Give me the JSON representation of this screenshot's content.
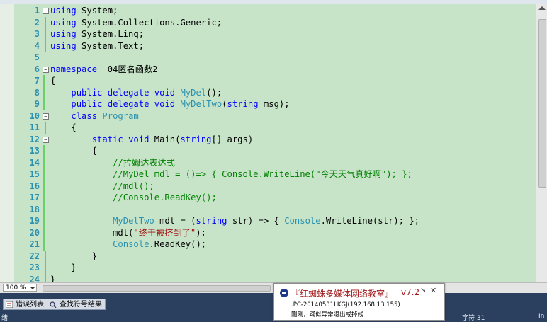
{
  "top_tabs": [
    "",
    ""
  ],
  "editor": {
    "lines": [
      {
        "n": "1",
        "fold": "−",
        "chg": false,
        "guide": false,
        "code": "<span class='kw'>using</span> System;"
      },
      {
        "n": "2",
        "fold": "",
        "chg": false,
        "guide": true,
        "code": "<span class='kw'>using</span> System.Collections.Generic;"
      },
      {
        "n": "3",
        "fold": "",
        "chg": false,
        "guide": true,
        "code": "<span class='kw'>using</span> System.Linq;"
      },
      {
        "n": "4",
        "fold": "",
        "chg": false,
        "guide": true,
        "code": "<span class='kw'>using</span> System.Text;"
      },
      {
        "n": "5",
        "fold": "",
        "chg": false,
        "guide": false,
        "code": ""
      },
      {
        "n": "6",
        "fold": "−",
        "chg": false,
        "guide": false,
        "code": "<span class='kw'>namespace</span> _04匿名函数2"
      },
      {
        "n": "7",
        "fold": "",
        "chg": true,
        "guide": false,
        "code": "{"
      },
      {
        "n": "8",
        "fold": "",
        "chg": true,
        "guide": false,
        "code": "    <span class='kw'>public</span> <span class='kw'>delegate</span> <span class='kw'>void</span> <span class='ty'>MyDel</span>();"
      },
      {
        "n": "9",
        "fold": "",
        "chg": true,
        "guide": false,
        "code": "    <span class='kw'>public</span> <span class='kw'>delegate</span> <span class='kw'>void</span> <span class='ty'>MyDelTwo</span>(<span class='kw'>string</span> msg);"
      },
      {
        "n": "10",
        "fold": "−",
        "chg": false,
        "guide": false,
        "code": "    <span class='kw'>class</span> <span class='ty'>Program</span>"
      },
      {
        "n": "11",
        "fold": "",
        "chg": false,
        "guide": true,
        "code": "    {"
      },
      {
        "n": "12",
        "fold": "−",
        "chg": false,
        "guide": false,
        "code": "        <span class='kw'>static</span> <span class='kw'>void</span> Main(<span class='kw'>string</span>[] args)"
      },
      {
        "n": "13",
        "fold": "",
        "chg": true,
        "guide": false,
        "code": "        {"
      },
      {
        "n": "14",
        "fold": "",
        "chg": true,
        "guide": false,
        "code": "            <span class='cm'>//拉姆达表达式</span>"
      },
      {
        "n": "15",
        "fold": "",
        "chg": true,
        "guide": false,
        "code": "            <span class='cm'>//MyDel mdl = ()=&gt; { Console.WriteLine(\"今天天气真好啊\"); };</span>"
      },
      {
        "n": "16",
        "fold": "",
        "chg": true,
        "guide": false,
        "code": "            <span class='cm'>//mdl();</span>"
      },
      {
        "n": "17",
        "fold": "",
        "chg": true,
        "guide": false,
        "code": "            <span class='cm'>//Console.ReadKey();</span>"
      },
      {
        "n": "18",
        "fold": "",
        "chg": true,
        "guide": false,
        "code": ""
      },
      {
        "n": "19",
        "fold": "",
        "chg": true,
        "guide": false,
        "code": "            <span class='ty'>MyDelTwo</span> mdt = (<span class='kw'>string</span> str) =&gt; { <span class='ty'>Console</span>.WriteLine(str); };"
      },
      {
        "n": "20",
        "fold": "",
        "chg": true,
        "guide": false,
        "code": "            mdt(<span class='st'>\"终于被挤到了\"</span>);"
      },
      {
        "n": "21",
        "fold": "",
        "chg": true,
        "guide": false,
        "code": "            <span class='ty'>Console</span>.ReadKey();"
      },
      {
        "n": "22",
        "fold": "",
        "chg": false,
        "guide": true,
        "code": "        }"
      },
      {
        "n": "23",
        "fold": "",
        "chg": false,
        "guide": true,
        "code": "    }"
      },
      {
        "n": "24",
        "fold": "",
        "chg": false,
        "guide": true,
        "code": "}"
      }
    ]
  },
  "zoom": {
    "value": "100 %"
  },
  "bottom_tabs": {
    "error_list": "错误列表",
    "find_symbol": "查找符号结果"
  },
  "status": {
    "left": "绪",
    "col": "字符 31",
    "far": "In"
  },
  "notification": {
    "title": "『红蜘蛛多媒体网络教室』",
    "version": "v7.2",
    "host": ".PC-20140531LKGJ(192.168.13.155)",
    "message": "刚刚，疑似异常退出或掉线",
    "close": "✕",
    "pin": "↘"
  },
  "colors": {
    "editor_bg": "#c7e4c8",
    "line_number": "#2b91af",
    "keyword": "#0000ff",
    "type": "#2b91af",
    "comment": "#008000",
    "string": "#a31515",
    "change_bar": "#6ad06a"
  }
}
